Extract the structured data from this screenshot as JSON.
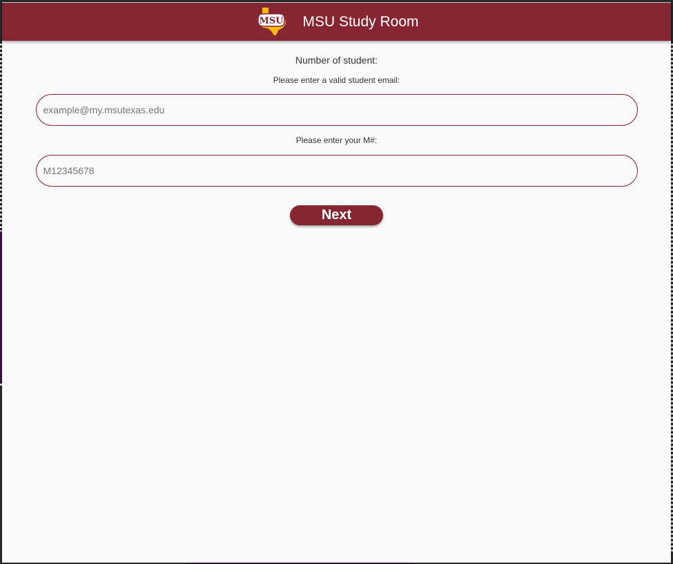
{
  "app": {
    "title": "MSU Study Room",
    "logo_text": "MSU"
  },
  "form": {
    "count_label": "Number of student:",
    "email_label": "Please enter a valid student email:",
    "email_placeholder": "example@my.msutexas.edu",
    "email_value": "",
    "mnum_label": "Please enter your M#:",
    "mnum_placeholder": "M12345678",
    "mnum_value": "",
    "next_label": "Next"
  },
  "colors": {
    "brand": "#862633",
    "accent": "#FDB913",
    "background": "#fafafa"
  }
}
